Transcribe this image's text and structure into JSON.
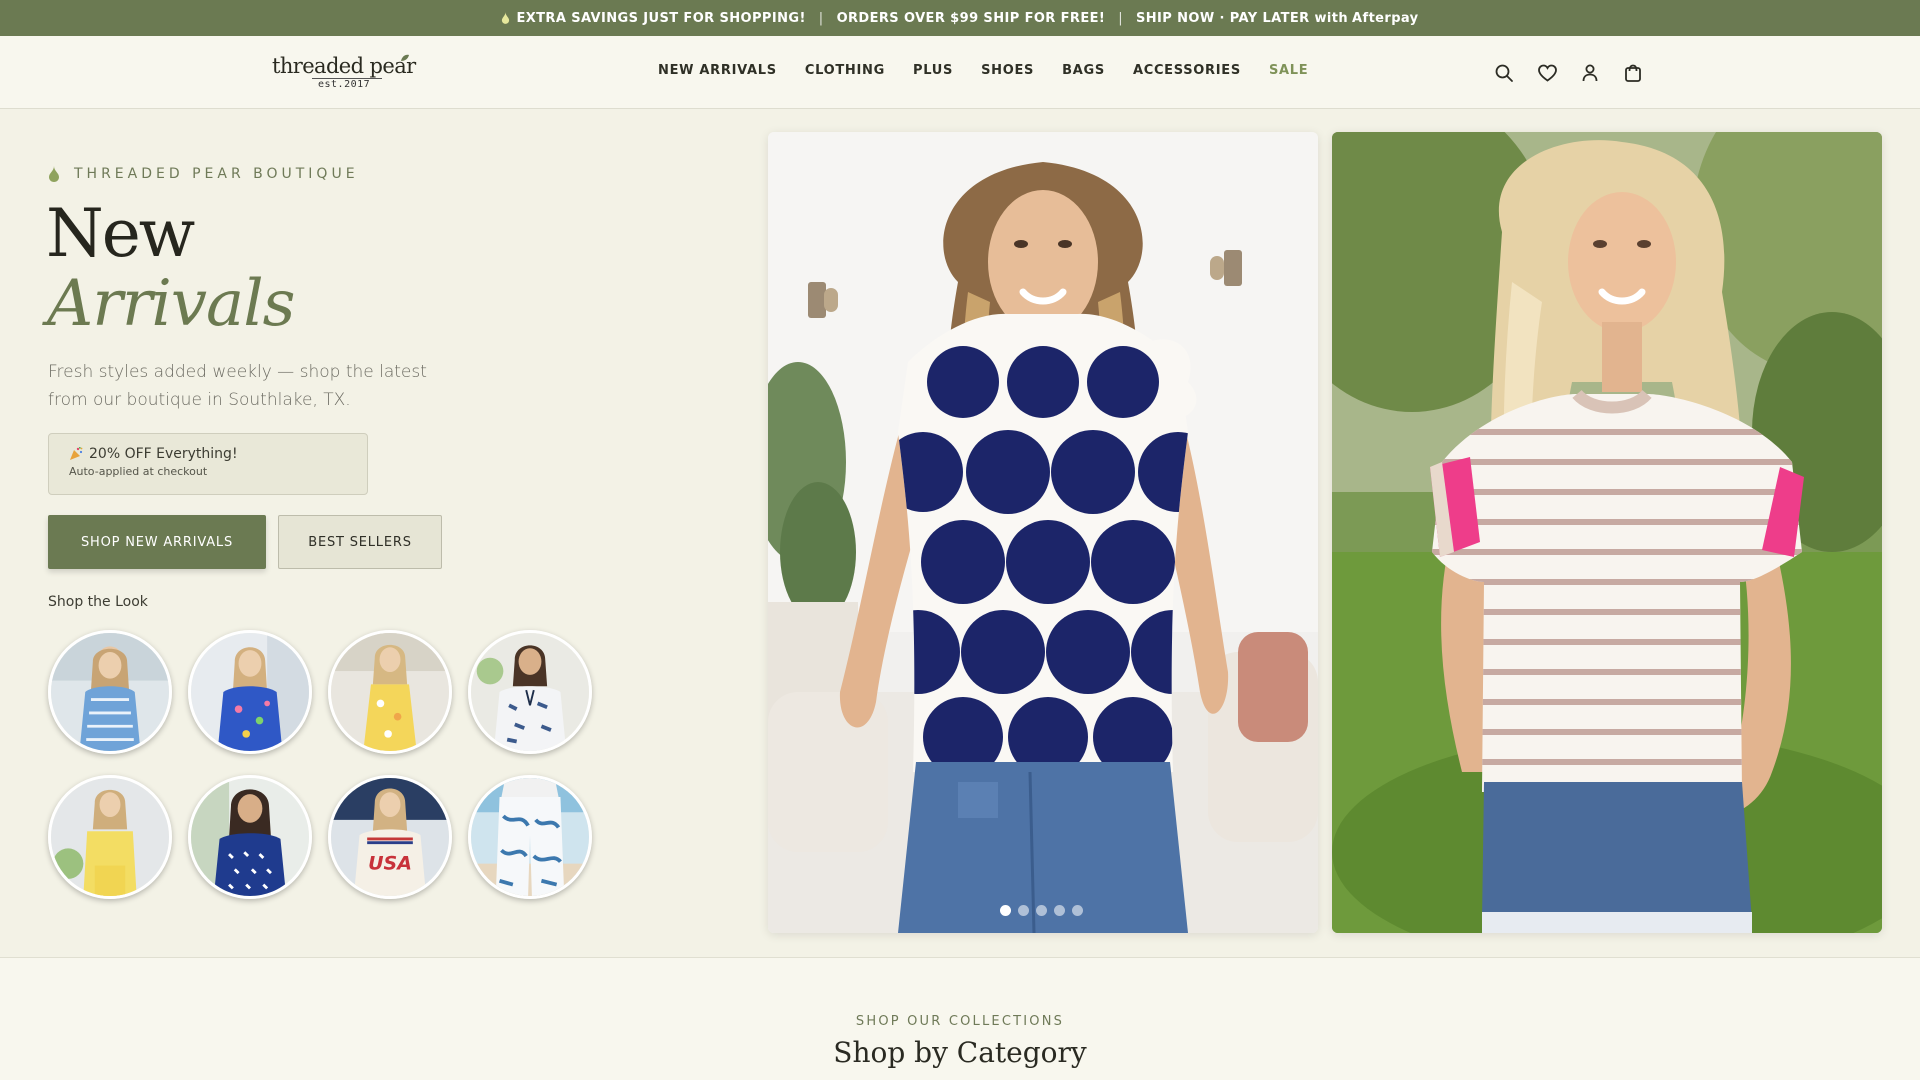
{
  "announcement": {
    "item1": "EXTRA SAVINGS JUST FOR SHOPPING!",
    "sep": "|",
    "item2": "ORDERS OVER $99 SHIP FOR FREE!",
    "item3_prefix": "SHIP NOW · PAY LATER with ",
    "item3_brand": "Afterpay"
  },
  "brand": {
    "logo_text": "threaded pear",
    "logo_est": "est.2017"
  },
  "nav": {
    "items": [
      "NEW ARRIVALS",
      "CLOTHING",
      "PLUS",
      "SHOES",
      "BAGS",
      "ACCESSORIES",
      "SALE"
    ]
  },
  "header_icons": [
    "search-icon",
    "heart-icon",
    "account-icon",
    "cart-icon"
  ],
  "hero": {
    "eyebrow": "THREADED PEAR BOUTIQUE",
    "title_line1": "New",
    "title_line2": "Arrivals",
    "subtitle": "Fresh styles added weekly — shop the latest from our boutique in Southlake, TX.",
    "promo_title": "20% OFF Everything!",
    "promo_subtitle": "Auto-applied at checkout",
    "btn_primary": "SHOP NEW ARRIVALS",
    "btn_secondary": "BEST SELLERS",
    "shop_look_label": "Shop the Look",
    "carousel_total": 5,
    "carousel_active": 1
  },
  "colors": {
    "brand_green": "#6b7a52",
    "sale_green": "#7f9258",
    "background": "#f3f2e6"
  },
  "collections": {
    "eyebrow": "SHOP OUR COLLECTIONS",
    "title": "Shop by Category"
  }
}
